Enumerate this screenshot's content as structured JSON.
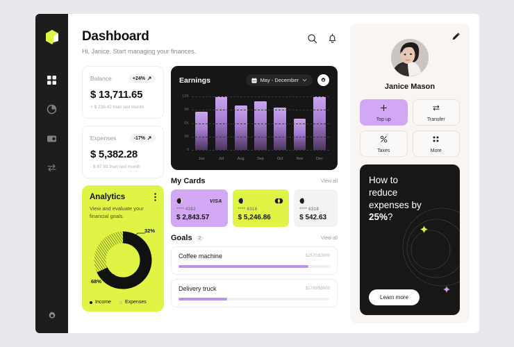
{
  "sidebar": {
    "logo_name": "cube-logo",
    "items": [
      {
        "name": "dashboard",
        "icon": "grid-icon",
        "active": true
      },
      {
        "name": "analytics",
        "icon": "pie-chart-icon",
        "active": false
      },
      {
        "name": "wallet",
        "icon": "wallet-icon",
        "active": false
      },
      {
        "name": "transfers",
        "icon": "transfer-arrows-icon",
        "active": false
      }
    ],
    "settings_icon": "gear-icon"
  },
  "header": {
    "title": "Dashboard",
    "subtitle": "Hi, Janice. Start managing your finances.",
    "search_icon": "search-icon",
    "bell_icon": "bell-icon"
  },
  "stats": [
    {
      "label": "Balance",
      "badge": "+24%",
      "value": "$ 13,711.65",
      "delta": "+ $ 238.42 than last month"
    },
    {
      "label": "Expenses",
      "badge": "-17%",
      "value": "$ 5,382.28",
      "delta": "- $ 87.93 than last month"
    }
  ],
  "analytics": {
    "title": "Analytics",
    "subtitle": "View and evaluate your financial goals.",
    "menu_icon": "more-vertical-icon",
    "pct_expenses": "32%",
    "pct_income": "68%",
    "legend": [
      {
        "label": "Income"
      },
      {
        "label": "Expenses"
      }
    ]
  },
  "earnings": {
    "title": "Earnings",
    "range_label": "May - December",
    "calendar_icon": "calendar-icon",
    "chevron_icon": "chevron-down-icon",
    "settings_icon": "gear-icon"
  },
  "chart_data": {
    "type": "bar",
    "title": "Earnings",
    "categories": [
      "Jun",
      "Jul",
      "Aug",
      "Sep",
      "Oct",
      "Nov",
      "Dec"
    ],
    "values": [
      8600,
      12000,
      10000,
      10900,
      9600,
      7000,
      12000
    ],
    "ytick_labels": [
      "12K",
      "9K",
      "6K",
      "3K",
      "0"
    ],
    "ytick_values": [
      12000,
      9000,
      6000,
      3000,
      0
    ],
    "ylim": [
      0,
      12800
    ],
    "xlabel": "",
    "ylabel": "",
    "grid": true,
    "legend": "none"
  },
  "my_cards": {
    "title": "My Cards",
    "view_all": "View all",
    "items": [
      {
        "number": "**** 4382",
        "amount": "$ 2,843.57",
        "brand": "VISA",
        "color": "#d2a8f5",
        "chip_icon": "card-chip-icon"
      },
      {
        "number": "**** 6318",
        "amount": "$ 5,246.86",
        "brand": "mastercard-icon",
        "color": "#dff444",
        "chip_icon": "card-chip-icon"
      },
      {
        "number": "**** 6318",
        "amount": "$ 542.63",
        "brand": "",
        "color": "#f3f3f3",
        "chip_icon": "card-chip-icon"
      }
    ]
  },
  "goals": {
    "title": "Goals",
    "count": "2",
    "view_all": "View all",
    "items": [
      {
        "name": "Coffee machine",
        "amount": "$2570/$3000",
        "progress": 86
      },
      {
        "name": "Delivery truck",
        "amount": "$1789/$5600",
        "progress": 32
      }
    ]
  },
  "profile": {
    "name": "Janice Mason",
    "edit_icon": "pencil-icon",
    "avatar_name": "user-avatar"
  },
  "quick_actions": [
    {
      "label": "Top up",
      "icon": "plus-icon",
      "primary": true
    },
    {
      "label": "Transfer",
      "icon": "transfer-arrows-icon",
      "primary": false
    },
    {
      "label": "Taxes",
      "icon": "percent-icon",
      "primary": false
    },
    {
      "label": "More",
      "icon": "grid-dots-icon",
      "primary": false
    }
  ],
  "promo": {
    "line1": "How to",
    "line2": "reduce",
    "line3": "expenses by",
    "highlight": "25%",
    "suffix": "?",
    "button": "Learn more"
  },
  "colors": {
    "accent_yellow": "#dff444",
    "accent_purple": "#d2a8f5",
    "dark": "#161616",
    "page_bg": "#e8e8ee",
    "panel_bg": "#f8f5f3"
  }
}
